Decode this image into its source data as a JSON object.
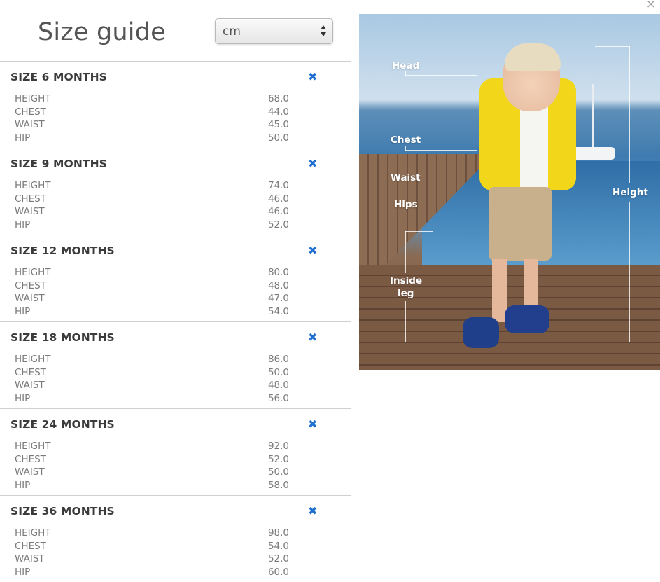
{
  "modal": {
    "close_label": "×"
  },
  "header": {
    "title": "Size guide"
  },
  "unit_select": {
    "selected": "cm"
  },
  "sections": [
    {
      "title": "SIZE 6 MONTHS",
      "close": "✖",
      "rows": [
        {
          "label": "HEIGHT",
          "value": "68.0"
        },
        {
          "label": "CHEST",
          "value": "44.0"
        },
        {
          "label": "WAIST",
          "value": "45.0"
        },
        {
          "label": "HIP",
          "value": "50.0"
        }
      ]
    },
    {
      "title": "SIZE 9 MONTHS",
      "close": "✖",
      "rows": [
        {
          "label": "HEIGHT",
          "value": "74.0"
        },
        {
          "label": "CHEST",
          "value": "46.0"
        },
        {
          "label": "WAIST",
          "value": "46.0"
        },
        {
          "label": "HIP",
          "value": "52.0"
        }
      ]
    },
    {
      "title": "SIZE 12 MONTHS",
      "close": "✖",
      "rows": [
        {
          "label": "HEIGHT",
          "value": "80.0"
        },
        {
          "label": "CHEST",
          "value": "48.0"
        },
        {
          "label": "WAIST",
          "value": "47.0"
        },
        {
          "label": "HIP",
          "value": "54.0"
        }
      ]
    },
    {
      "title": "SIZE 18 MONTHS",
      "close": "✖",
      "rows": [
        {
          "label": "HEIGHT",
          "value": "86.0"
        },
        {
          "label": "CHEST",
          "value": "50.0"
        },
        {
          "label": "WAIST",
          "value": "48.0"
        },
        {
          "label": "HIP",
          "value": "56.0"
        }
      ]
    },
    {
      "title": "SIZE 24 MONTHS",
      "close": "✖",
      "rows": [
        {
          "label": "HEIGHT",
          "value": "92.0"
        },
        {
          "label": "CHEST",
          "value": "52.0"
        },
        {
          "label": "WAIST",
          "value": "50.0"
        },
        {
          "label": "HIP",
          "value": "58.0"
        }
      ]
    },
    {
      "title": "SIZE 36 MONTHS",
      "close": "✖",
      "rows": [
        {
          "label": "HEIGHT",
          "value": "98.0"
        },
        {
          "label": "CHEST",
          "value": "54.0"
        },
        {
          "label": "WAIST",
          "value": "52.0"
        },
        {
          "label": "HIP",
          "value": "60.0"
        }
      ]
    }
  ],
  "measurement_image": {
    "labels": {
      "head": "Head",
      "chest": "Chest",
      "waist": "Waist",
      "hips": "Hips",
      "inside_leg_1": "Inside",
      "inside_leg_2": "leg",
      "height": "Height"
    }
  }
}
